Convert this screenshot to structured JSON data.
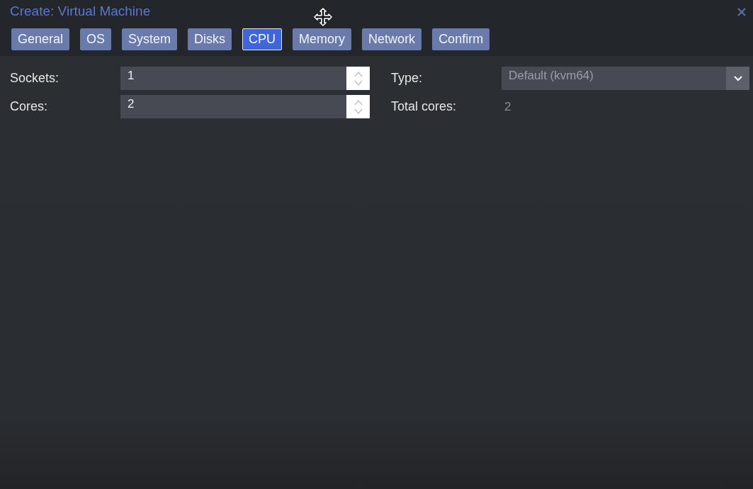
{
  "window": {
    "title": "Create: Virtual Machine"
  },
  "tabs": [
    {
      "label": "General",
      "selected": false
    },
    {
      "label": "OS",
      "selected": false
    },
    {
      "label": "System",
      "selected": false
    },
    {
      "label": "Disks",
      "selected": false
    },
    {
      "label": "CPU",
      "selected": true
    },
    {
      "label": "Memory",
      "selected": false
    },
    {
      "label": "Network",
      "selected": false
    },
    {
      "label": "Confirm",
      "selected": false
    }
  ],
  "left_fields": [
    {
      "label": "Sockets:",
      "value": "1",
      "kind": "spinner"
    },
    {
      "label": "Cores:",
      "value": "2",
      "kind": "spinner"
    }
  ],
  "right_fields": [
    {
      "label": "Type:",
      "value": "Default (kvm64)",
      "kind": "dropdown"
    },
    {
      "label": "Total cores:",
      "value": "2",
      "kind": "display"
    }
  ]
}
